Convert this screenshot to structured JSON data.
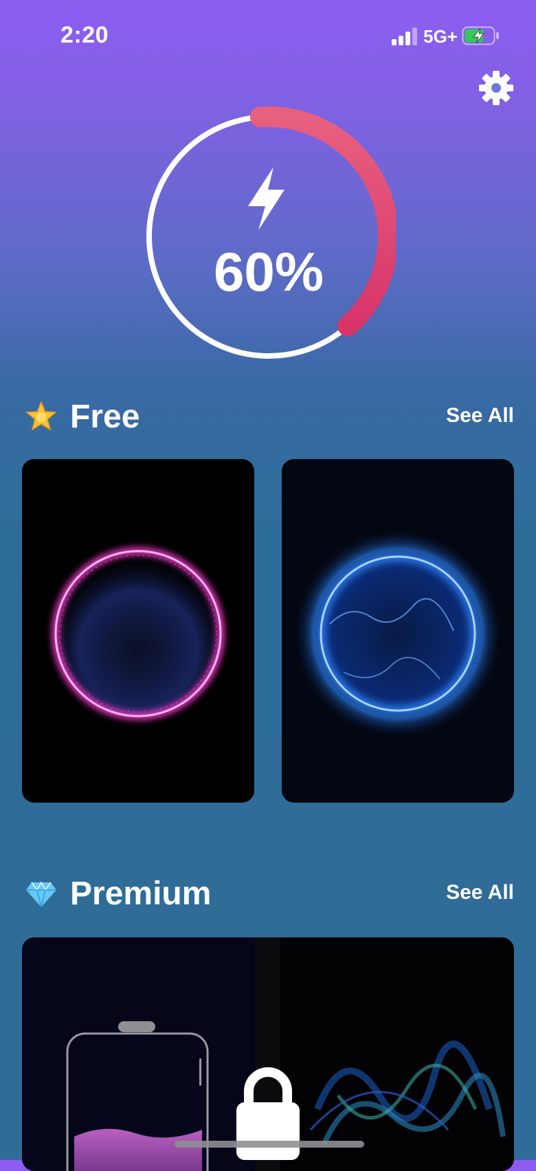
{
  "status_bar": {
    "time": "2:20",
    "network": "5G+",
    "battery_charging": true
  },
  "battery": {
    "percent_label": "60%",
    "level": 0.6,
    "ring_accent": "#e23d6d"
  },
  "sections": {
    "free": {
      "title": "Free",
      "see_all": "See All",
      "icon": "star-emoji"
    },
    "premium": {
      "title": "Premium",
      "see_all": "See All",
      "icon": "gem-emoji"
    }
  },
  "colors": {
    "pink_glow": "#ff3cd2",
    "blue_glow": "#2f86ff"
  }
}
